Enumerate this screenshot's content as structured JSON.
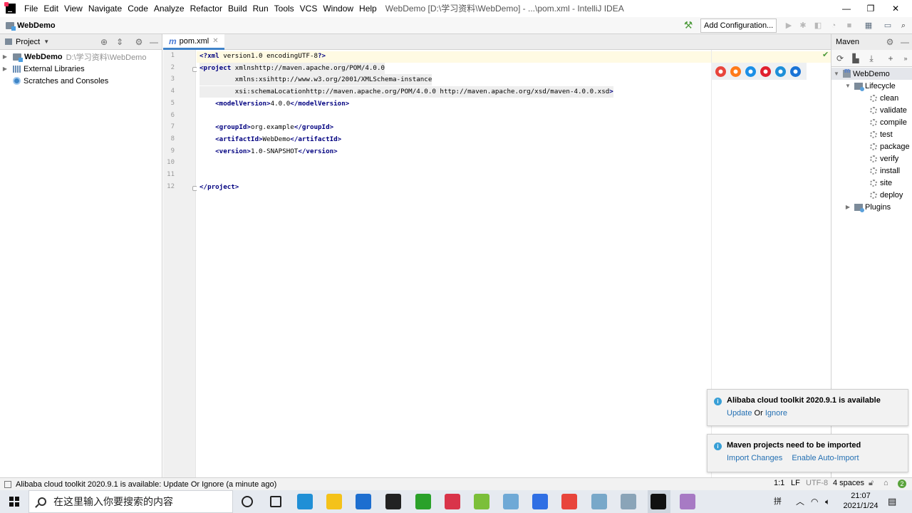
{
  "window": {
    "title": "WebDemo [D:\\学习资料\\WebDemo] - ...\\pom.xml - IntelliJ IDEA",
    "menu": [
      "File",
      "Edit",
      "View",
      "Navigate",
      "Code",
      "Analyze",
      "Refactor",
      "Build",
      "Run",
      "Tools",
      "VCS",
      "Window",
      "Help"
    ],
    "controls": {
      "minimize": "—",
      "restore": "❐",
      "close": "✕"
    }
  },
  "navbar": {
    "project_name": "WebDemo",
    "add_configuration": "Add Configuration..."
  },
  "project_panel": {
    "title": "Project",
    "tree": [
      {
        "label": "WebDemo",
        "path": "D:\\学习资料\\WebDemo",
        "bold": true
      },
      {
        "label": "External Libraries"
      },
      {
        "label": "Scratches and Consoles"
      }
    ]
  },
  "editor": {
    "tab_label": "pom.xml",
    "lines": [
      "<?xml version=\"1.0\" encoding=\"UTF-8\"?>",
      "<project xmlns=\"http://maven.apache.org/POM/4.0.0\"",
      "         xmlns:xsi=\"http://www.w3.org/2001/XMLSchema-instance\"",
      "         xsi:schemaLocation=\"http://maven.apache.org/POM/4.0.0 http://maven.apache.org/xsd/maven-4.0.0.xsd\">",
      "    <modelVersion>4.0.0</modelVersion>",
      "",
      "    <groupId>org.example</groupId>",
      "    <artifactId>WebDemo</artifactId>",
      "    <version>1.0-SNAPSHOT</version>",
      "",
      "",
      "</project>"
    ],
    "line_numbers": [
      "1",
      "2",
      "3",
      "4",
      "5",
      "6",
      "7",
      "8",
      "9",
      "10",
      "11",
      "12"
    ],
    "browsers": [
      {
        "name": "chrome-icon",
        "color": "#e8453c"
      },
      {
        "name": "firefox-icon",
        "color": "#ff7a1a"
      },
      {
        "name": "safari-icon",
        "color": "#1b8fe6"
      },
      {
        "name": "opera-icon",
        "color": "#e0202e"
      },
      {
        "name": "ie-icon",
        "color": "#1e8fd8"
      },
      {
        "name": "edge-icon",
        "color": "#1a73d6"
      }
    ]
  },
  "maven": {
    "title": "Maven",
    "project": "WebDemo",
    "lifecycle_label": "Lifecycle",
    "goals": [
      "clean",
      "validate",
      "compile",
      "test",
      "package",
      "verify",
      "install",
      "site",
      "deploy"
    ],
    "plugins_label": "Plugins"
  },
  "notifications": [
    {
      "title": "Alibaba cloud toolkit 2020.9.1 is available",
      "link1": "Update",
      "sep": " Or ",
      "link2": "Ignore"
    },
    {
      "title": "Maven projects need to be imported",
      "link1": "Import Changes",
      "sep": "",
      "link2": "Enable Auto-Import"
    }
  ],
  "statusbar": {
    "message": "Alibaba cloud toolkit 2020.9.1 is available: Update Or Ignore (a minute ago)",
    "position": "1:1",
    "line_sep": "LF",
    "encoding": "UTF-8",
    "indent": "4 spaces",
    "badge": "2"
  },
  "taskbar": {
    "search_placeholder": "在这里输入你要搜索的内容",
    "ime": "拼",
    "time": "21:07",
    "date": "2021/1/24",
    "apps": [
      {
        "name": "cortana-icon",
        "color": "#222222"
      },
      {
        "name": "task-view-icon",
        "color": "#222222"
      },
      {
        "name": "edge-app-icon",
        "color": "#1f8fd6"
      },
      {
        "name": "file-explorer-icon",
        "color": "#f4c21a"
      },
      {
        "name": "mail-icon",
        "color": "#1c6ed0"
      },
      {
        "name": "store-icon",
        "color": "#222222"
      },
      {
        "name": "ie-app-icon",
        "color": "#2aa12a"
      },
      {
        "name": "xmind-icon",
        "color": "#d9344a"
      },
      {
        "name": "notepadpp-icon",
        "color": "#7bbf3a"
      },
      {
        "name": "app-9-icon",
        "color": "#6fa9d6"
      },
      {
        "name": "wps-icon",
        "color": "#2f6fe4"
      },
      {
        "name": "chrome-app-icon",
        "color": "#e8453c"
      },
      {
        "name": "app-12-icon",
        "color": "#78a8c9"
      },
      {
        "name": "app-13-icon",
        "color": "#8aa4b8"
      },
      {
        "name": "intellij-icon",
        "color": "#111111"
      },
      {
        "name": "paint-icon",
        "color": "#a77ac4"
      }
    ]
  }
}
